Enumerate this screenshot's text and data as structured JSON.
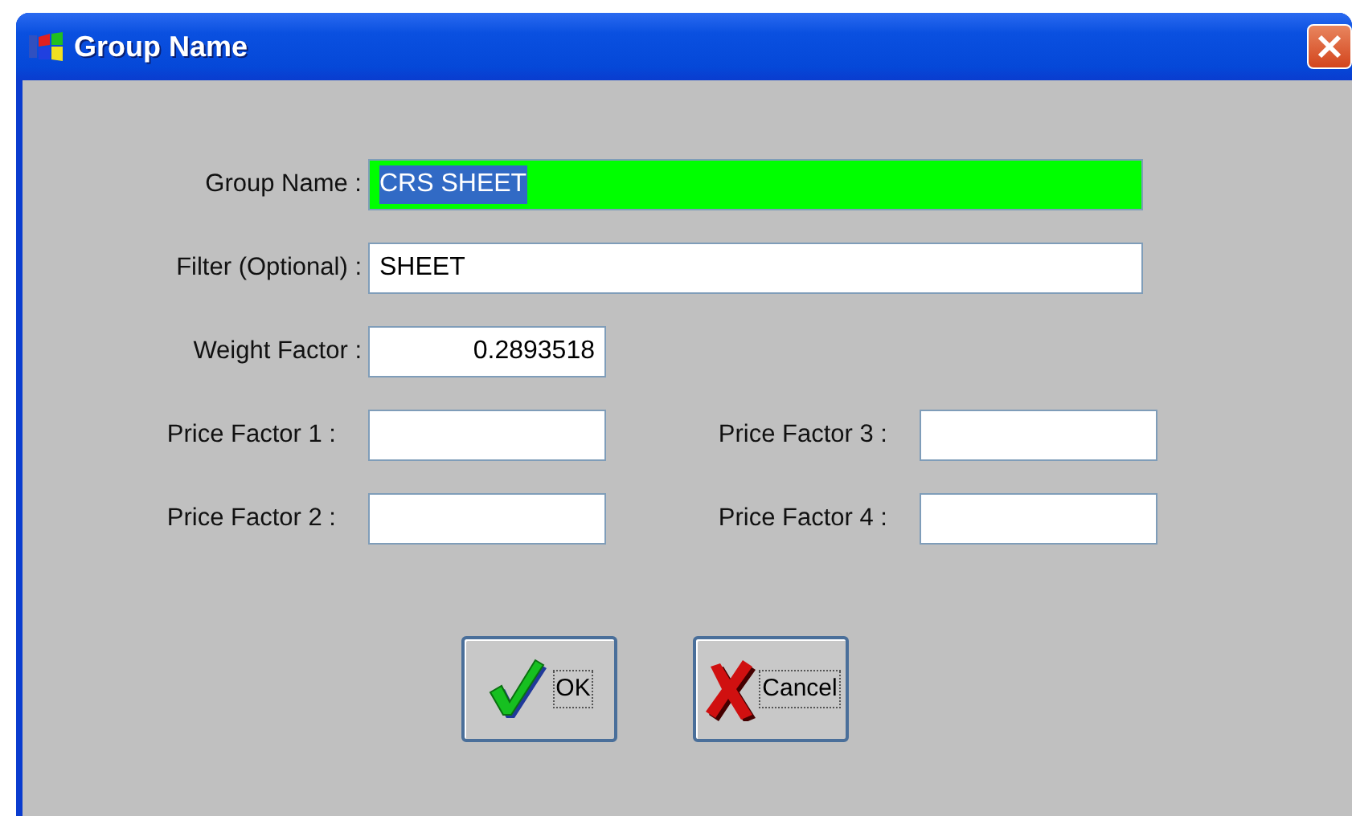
{
  "window": {
    "title": "Group Name"
  },
  "fields": [
    {
      "label": "Group Name :",
      "value": "CRS SHEET",
      "kind": "wide",
      "highlighted": true,
      "text_selected": true
    },
    {
      "label": "Filter (Optional) :",
      "value": "SHEET",
      "kind": "wide",
      "highlighted": false,
      "text_selected": false
    },
    {
      "label": "Weight Factor :",
      "value": "0.2893518",
      "kind": "number",
      "highlighted": false,
      "text_selected": false
    }
  ],
  "price_factors": [
    {
      "label": "Price Factor 1 :"
    },
    {
      "label": "Price Factor 3 :"
    },
    {
      "label": "Price Factor 2 :"
    },
    {
      "label": "Price Factor 4 :"
    }
  ],
  "buttons": [
    {
      "label": "OK",
      "kind": "ok"
    },
    {
      "label": "Cancel",
      "kind": "cancel"
    }
  ]
}
